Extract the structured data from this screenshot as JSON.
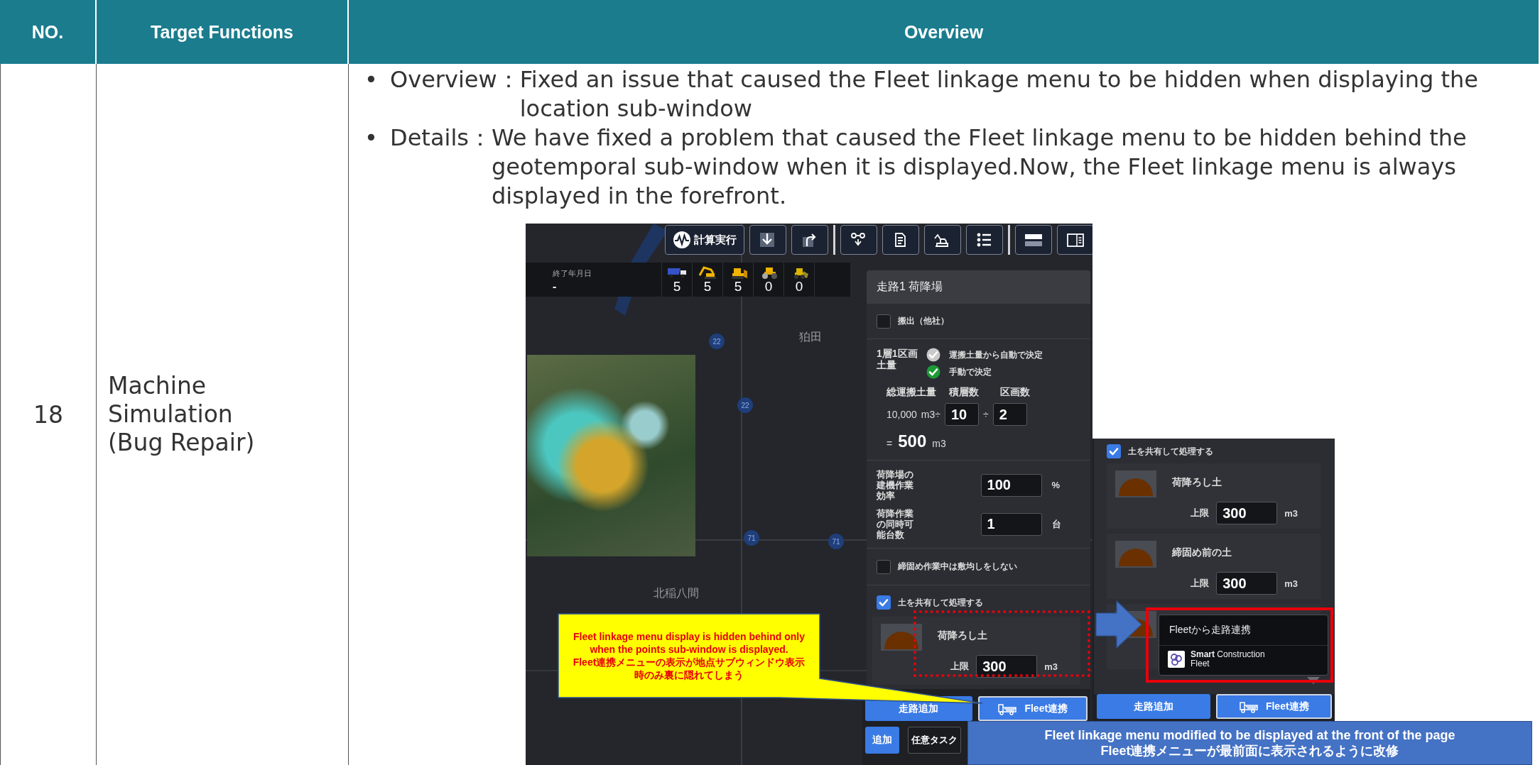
{
  "table": {
    "columns": [
      {
        "label": "NO."
      },
      {
        "label": "Target Functions"
      },
      {
        "label": "Overview"
      }
    ],
    "rows": [
      {
        "no": "18",
        "target": "Machine Simulation (Bug Repair)",
        "bullets": [
          {
            "marker": "•",
            "label": "Overview：",
            "text": "Fixed an issue that caused the Fleet linkage menu to be hidden when displaying the location sub-window"
          },
          {
            "marker": "•",
            "label": "Details：",
            "text": "We have fixed a problem that caused the Fleet linkage menu to be hidden behind the geotemporal sub-window when it is displayed.Now, the Fleet linkage menu is always displayed in the forefront."
          }
        ],
        "before_screen": {
          "toolbar": [
            {
              "kind": "run",
              "label": "計算実行"
            },
            {
              "kind": "download"
            },
            {
              "kind": "redo"
            },
            {
              "kind": "separator"
            },
            {
              "kind": "route"
            },
            {
              "kind": "document"
            },
            {
              "kind": "excavator"
            },
            {
              "kind": "list"
            },
            {
              "kind": "separator"
            },
            {
              "kind": "rows"
            },
            {
              "kind": "panel"
            }
          ],
          "stats": {
            "label": "終了年月日",
            "value": "-",
            "machines": [
              {
                "kind": "dump-truck",
                "count": "5"
              },
              {
                "kind": "excavator",
                "count": "5"
              },
              {
                "kind": "bulldozer",
                "count": "5"
              },
              {
                "kind": "roller",
                "count": "0"
              },
              {
                "kind": "loader",
                "count": "0"
              }
            ]
          },
          "map_labels": [
            {
              "kind": "route",
              "text": "22"
            },
            {
              "kind": "route",
              "text": "22"
            },
            {
              "kind": "place",
              "text": "狛田"
            },
            {
              "kind": "route",
              "text": "71"
            },
            {
              "kind": "route",
              "text": "71"
            },
            {
              "kind": "place",
              "text": "北稲八間"
            }
          ],
          "panel": {
            "title": "走路1 荷降場",
            "export_checkbox": {
              "label": "搬出（他社）",
              "checked": false
            },
            "volume": {
              "label": "1層1区画土量",
              "options": [
                {
                  "label": "運搬土量から自動で決定",
                  "selected": false
                },
                {
                  "label": "手動で決定",
                  "selected": true
                }
              ],
              "headers": [
                "総運搬土量",
                "積層数",
                "区画数"
              ],
              "total": "10,000",
              "total_unit": "m3÷",
              "layers": "10",
              "divide": "÷",
              "sections": "2",
              "equals": "=",
              "result": "500",
              "result_unit": "m3"
            },
            "fields": [
              {
                "label": "荷降場の建機作業効率",
                "value": "100",
                "unit": "%"
              },
              {
                "label": "荷降作業の同時可能台数",
                "value": "1",
                "unit": "台"
              }
            ],
            "checkboxes": [
              {
                "label": "締固め作業中は敷均しをしない",
                "checked": false
              },
              {
                "label": "土を共有して処理する",
                "checked": true
              }
            ],
            "soils": [
              {
                "kind": "full",
                "name": "荷降ろし土",
                "limit_label": "上限",
                "value": "300",
                "unit": "m3"
              }
            ],
            "buttons": [
              {
                "kind": "plain",
                "label": "走路追加"
              },
              {
                "kind": "fleet",
                "label": "Fleet連携"
              }
            ],
            "bottom_buttons": [
              {
                "kind": "primary",
                "label": "追加"
              },
              {
                "kind": "secondary",
                "label": "任意タスク"
              }
            ]
          }
        },
        "after_screen": {
          "checkbox": {
            "label": "土を共有して処理する",
            "checked": true
          },
          "soils": [
            {
              "kind": "full",
              "name": "荷降ろし土",
              "limit_label": "上限",
              "value": "300",
              "unit": "m3"
            },
            {
              "kind": "full",
              "name": "締固め前の土",
              "limit_label": "上限",
              "value": "300",
              "unit": "m3"
            },
            {
              "kind": "icon-only"
            }
          ],
          "menu": {
            "title": "Fleetから走路連携",
            "items": [
              {
                "lines": [
                  "**Smart** Construction",
                  "Fleet"
                ]
              }
            ]
          },
          "buttons": [
            {
              "kind": "plain",
              "label": "走路追加"
            },
            {
              "kind": "fleet",
              "label": "Fleet連携"
            }
          ]
        },
        "annotations": {
          "problem_callout": [
            "Fleet linkage menu display is hidden behind only when the points sub-window is displayed.",
            "Fleet連携メニューの表示が地点サブウィンドウ表示時のみ裏に隠れてしまう"
          ],
          "fix_note": [
            "Fleet linkage menu modified to be displayed at the front of the page",
            "Fleet連携メニューが最前面に表示されるように改修"
          ]
        }
      }
    ]
  }
}
